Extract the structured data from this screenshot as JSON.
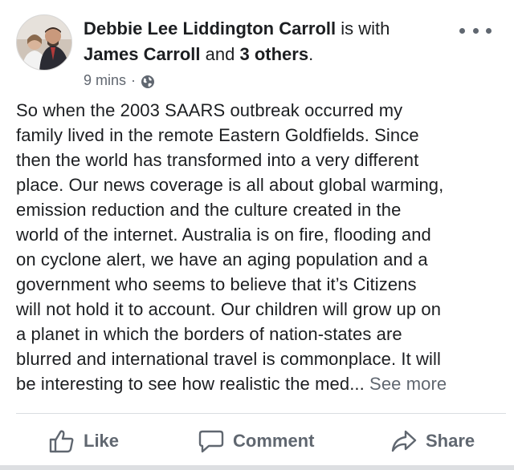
{
  "post": {
    "author": "Debbie Lee Liddington Carroll",
    "with_prefix": "is with",
    "tagged_person": "James Carroll",
    "and_text": "and",
    "others": "3 others",
    "period": ".",
    "time": "9 mins",
    "time_separator": "·",
    "privacy_icon": "globe-icon",
    "menu_icon": "more-horizontal-icon",
    "body_lines": [
      "So when the 2003 SAARS outbreak occurred my",
      "family lived in the remote Eastern Goldfields. Since",
      "then the world has transformed into a very different",
      "place. Our news coverage is all about global warming,",
      "emission reduction and the culture created in the",
      "world of the internet. Australia is on fire, flooding and",
      "on cyclone alert, we have an aging population and a",
      "government who seems to believe that it’s Citizens",
      "will not hold it to account. Our children will grow up on",
      "a planet in which the borders of nation-states are",
      "blurred and international travel is commonplace. It will"
    ],
    "last_line": "be interesting to see how realistic the med...",
    "see_more": "See more"
  },
  "actions": {
    "like": "Like",
    "comment": "Comment",
    "share": "Share"
  },
  "colors": {
    "text": "#1c1e21",
    "secondary": "#606770",
    "divider": "#dadde1"
  }
}
